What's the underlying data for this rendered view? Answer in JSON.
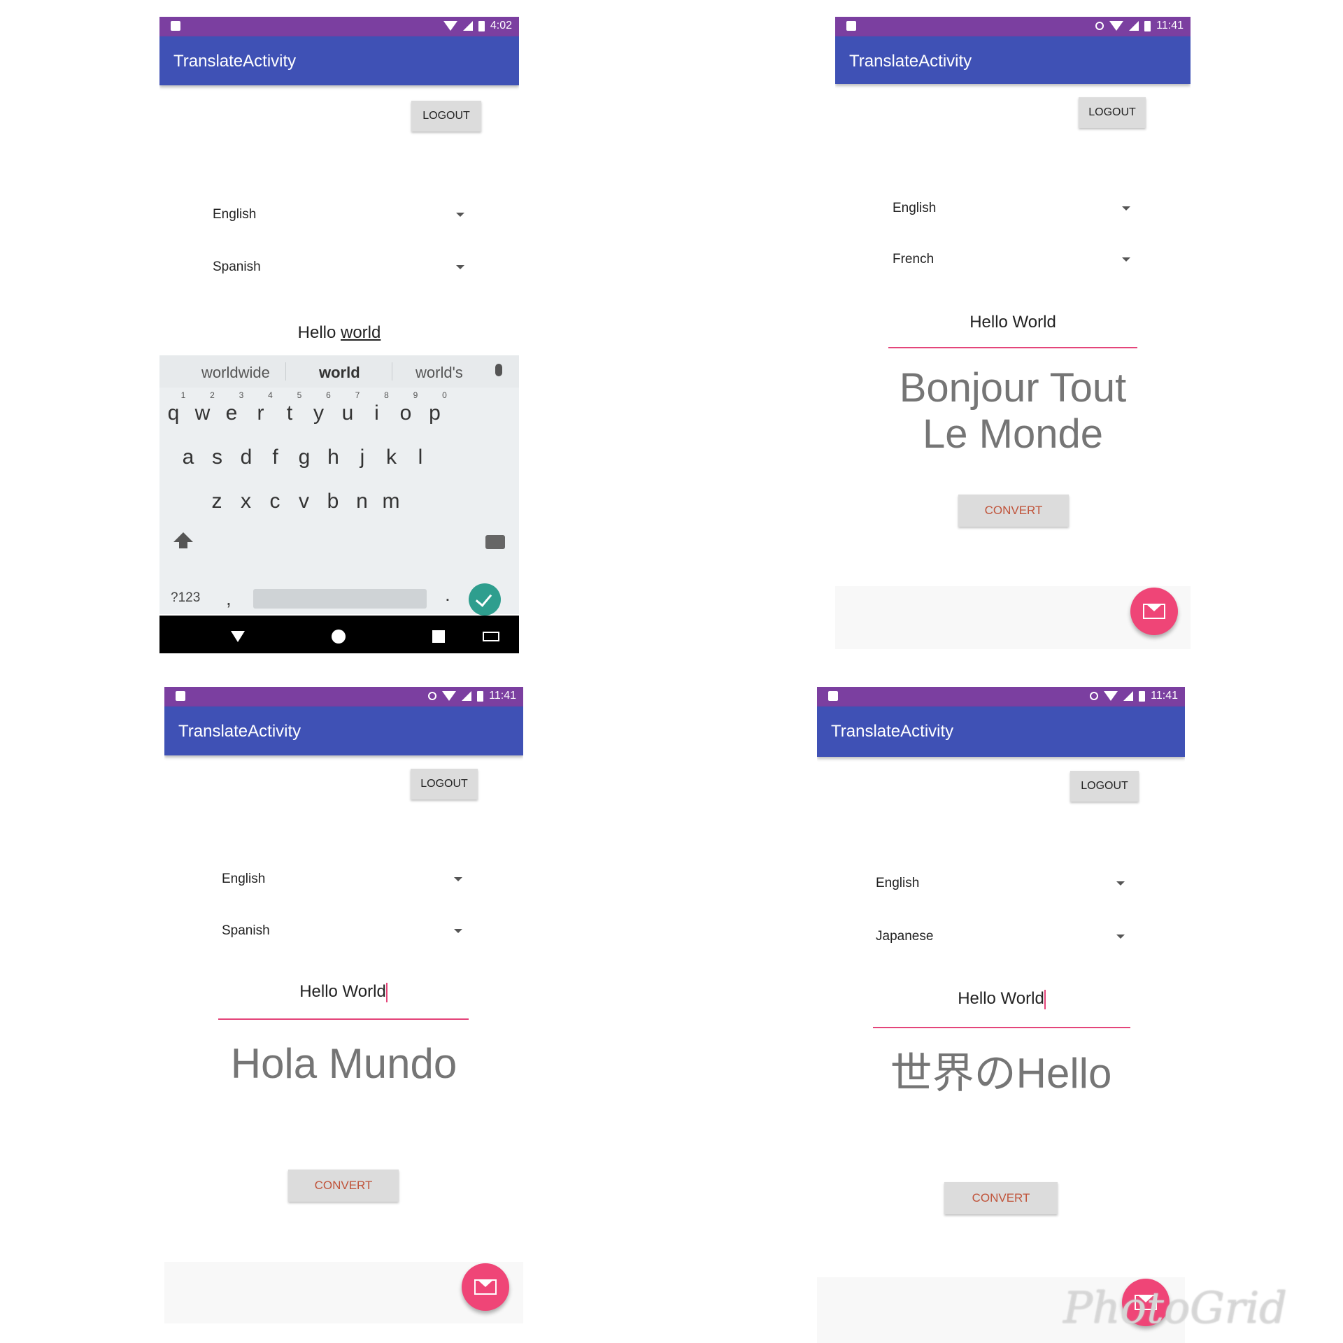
{
  "panel1": {
    "status_time": "4:02",
    "title": "TranslateActivity",
    "logout": "LOGOUT",
    "from_lang": "English",
    "to_lang": "Spanish",
    "input_plain": "Hello ",
    "input_underlined": "world",
    "suggestions": [
      "worldwide",
      "world",
      "world's"
    ],
    "row1": [
      "q",
      "w",
      "e",
      "r",
      "t",
      "y",
      "u",
      "i",
      "o",
      "p"
    ],
    "row1_nums": [
      "1",
      "2",
      "3",
      "4",
      "5",
      "6",
      "7",
      "8",
      "9",
      "0"
    ],
    "row2": [
      "a",
      "s",
      "d",
      "f",
      "g",
      "h",
      "j",
      "k",
      "l"
    ],
    "row3": [
      "z",
      "x",
      "c",
      "v",
      "b",
      "n",
      "m"
    ],
    "sym_key": "?123",
    "comma": ",",
    "period": "."
  },
  "panel2": {
    "status_time": "11:41",
    "title": "TranslateActivity",
    "logout": "LOGOUT",
    "from_lang": "English",
    "to_lang": "French",
    "input": "Hello World",
    "result_line1": "Bonjour Tout",
    "result_line2": "Le Monde",
    "convert": "CONVERT"
  },
  "panel3": {
    "status_time": "11:41",
    "title": "TranslateActivity",
    "logout": "LOGOUT",
    "from_lang": "English",
    "to_lang": "Spanish",
    "input": "Hello World",
    "result": "Hola Mundo",
    "convert": "CONVERT"
  },
  "panel4": {
    "status_time": "11:41",
    "title": "TranslateActivity",
    "logout": "LOGOUT",
    "from_lang": "English",
    "to_lang": "Japanese",
    "input": "Hello World",
    "result": "世界のHello",
    "convert": "CONVERT"
  },
  "watermark": "PhotoGrid",
  "colors": {
    "status_bar": "#7b3fa0",
    "app_bar": "#3f51b5",
    "accent": "#e4457a",
    "fab": "#ef4577",
    "convert_text": "#c0533a"
  }
}
